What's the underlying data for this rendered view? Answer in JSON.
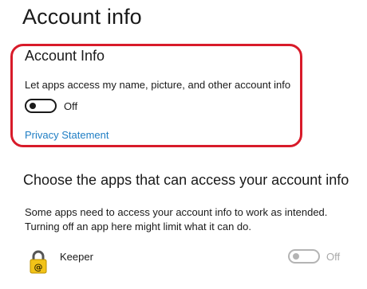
{
  "page": {
    "title": "Account info"
  },
  "account_info": {
    "title": "Account Info",
    "toggle_description": "Let apps access my name, picture, and other account info",
    "toggle_state": "Off",
    "privacy_link": "Privacy Statement"
  },
  "apps_section": {
    "heading": "Choose the apps that can access your account info",
    "description_line1": "Some apps need to access your account info to work as intended.",
    "description_line2": "Turning off an app here might limit what it can do.",
    "apps": [
      {
        "name": "Keeper",
        "icon": "keeper-lock-icon",
        "toggle_state": "Off"
      }
    ]
  },
  "colors": {
    "highlight": "#d81b2a",
    "link": "#1f7ec4",
    "keeper_yellow": "#f2c318"
  }
}
